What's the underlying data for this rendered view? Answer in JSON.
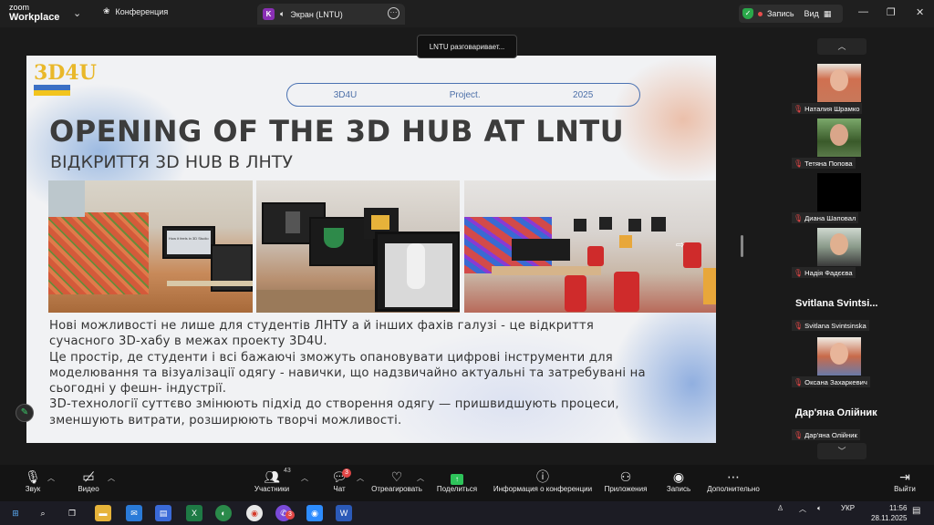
{
  "titlebar": {
    "logo_line1": "zoom",
    "logo_line2": "Workplace",
    "conference_label": "Конференция",
    "tab_letter": "K",
    "tab_label": "Экран (LNTU)",
    "record_label": "Запись",
    "view_label": "Вид"
  },
  "speaking_banner": "LNTU разговаривает...",
  "slide": {
    "logo_text": "3D4U",
    "pill": [
      "3D4U",
      "Project.",
      "2025"
    ],
    "title": "OPENING OF THE 3D HUB AT LNTU",
    "subtitle": "ВІДКРИТТЯ 3D HUB В ЛНТУ",
    "monitor_caption": "How it feels in 3D Studio",
    "body": [
      "Нові можливості не лише для студентів ЛНТУ а й інших фахів галузі - це відкриття",
      "сучасного 3D-хабу в межах проекту 3D4U.",
      "Це простір, де студенти і всі бажаючі зможуть опановувати цифрові інструменти для",
      "моделювання та візуалізації одягу - навички, що надзвичайно актуальні та затребувані на",
      "сьогодні у фешн- індустрії.",
      "3D-технології суттєво змінюють підхід до створення одягу — пришвидшують процеси,",
      "зменшують витрати, розширюють творчі можливості."
    ]
  },
  "participants": [
    {
      "name": "Наталия Шрамко",
      "muted": true
    },
    {
      "name": "Тетяна Попова",
      "muted": true
    },
    {
      "name": "Диана Шаповал",
      "muted": true
    },
    {
      "name": "Надія Фадєєва",
      "muted": true
    },
    {
      "display": "Svitlana  Svintsi...",
      "name": "Svitlana Svintsinska",
      "muted": true
    },
    {
      "name": "Оксана Захаркевич",
      "muted": true
    },
    {
      "display": "Дар'яна Олійник",
      "name": "Дар'яна Олійник",
      "muted": true
    }
  ],
  "toolbar": {
    "audio": "Звук",
    "video": "Видео",
    "participants": "Участники",
    "participants_count": "43",
    "chat": "Чат",
    "chat_badge": "3",
    "react": "Отреагировать",
    "share": "Поделиться",
    "info": "Информация о конференции",
    "apps": "Приложения",
    "record": "Запись",
    "more": "Дополнительно",
    "leave": "Выйти"
  },
  "taskbar": {
    "lang": "УКР",
    "time": "11:56",
    "date": "28.11.2025",
    "viber_badge": "3"
  },
  "colors": {
    "zoom_bg": "#1a1a1a",
    "mute_red": "#e24646",
    "share_green": "#2ec35a",
    "slide_accent": "#4b72b2"
  }
}
